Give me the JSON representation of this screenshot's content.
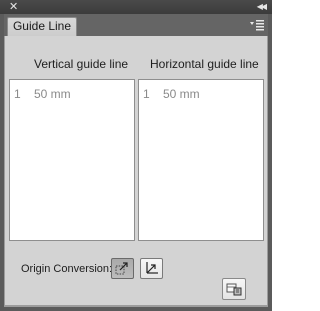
{
  "window": {
    "close_glyph": "✕",
    "collapse_glyph": "◀◀"
  },
  "tab": {
    "label": "Guide Line"
  },
  "vertical": {
    "title": "Vertical guide line",
    "rows": [
      {
        "index": "1",
        "value": "50 mm"
      }
    ]
  },
  "horizontal": {
    "title": "Horizontal guide line",
    "rows": [
      {
        "index": "1",
        "value": "50 mm"
      }
    ]
  },
  "origin": {
    "label": "Origin Conversion:"
  },
  "icons": {
    "panel_menu": "panel-menu-icon",
    "origin_top_left": "origin-top-left-icon",
    "origin_bottom_left": "origin-bottom-left-icon",
    "apply_guides": "apply-guides-icon"
  }
}
